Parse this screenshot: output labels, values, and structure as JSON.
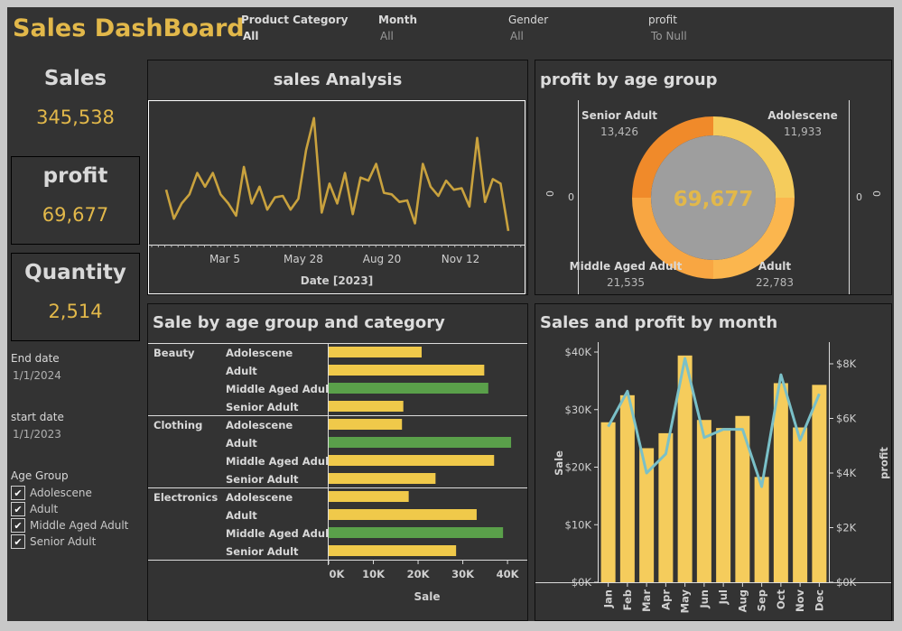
{
  "header": {
    "title": "Sales DashBoard",
    "filters": [
      {
        "label": "Product Category",
        "value": "All"
      },
      {
        "label": "Month",
        "value": "All"
      },
      {
        "label": "Gender",
        "value": "All"
      },
      {
        "label": "profit",
        "value": "To Null"
      }
    ]
  },
  "kpis": {
    "sales_label": "Sales",
    "sales_value": "345,538",
    "profit_label": "profit",
    "profit_value": "69,677",
    "quantity_label": "Quantity",
    "quantity_value": "2,514"
  },
  "sidebar": {
    "end_date_label": "End date",
    "end_date_value": "1/1/2024",
    "start_date_label": "start date",
    "start_date_value": "1/1/2023",
    "age_group_label": "Age Group",
    "age_groups": [
      {
        "label": "Adolescene",
        "checked": true
      },
      {
        "label": "Adult",
        "checked": true
      },
      {
        "label": "Middle Aged Adult",
        "checked": true
      },
      {
        "label": "Senior Adult",
        "checked": true
      }
    ]
  },
  "colors": {
    "accent": "#e2b84a",
    "bar_yellow": "#f0c94a",
    "bar_green": "#5aa04a",
    "line_teal": "#7ac0c8",
    "donut_orange": "#f08a2a"
  },
  "panels": {
    "sales_analysis_title": "sales Analysis",
    "profit_age_title": "profit by age group",
    "age_category_title": "Sale by age group and category",
    "month_title": "Sales and profit by month"
  },
  "chart_data": [
    {
      "type": "line",
      "title": "sales Analysis",
      "xlabel": "Date [2023]",
      "x_ticks": [
        "Mar 5",
        "May 28",
        "Aug 20",
        "Nov 12"
      ],
      "values": [
        5600,
        3700,
        4700,
        5300,
        6700,
        5800,
        6700,
        5300,
        4700,
        3900,
        7100,
        4700,
        5800,
        4300,
        5100,
        5200,
        4300,
        5000,
        8200,
        10300,
        4100,
        6000,
        4700,
        6700,
        4000,
        6400,
        6200,
        7300,
        5400,
        5300,
        4800,
        4900,
        3400,
        7300,
        5800,
        5200,
        6200,
        5600,
        5700,
        4500,
        9000,
        4800,
        6300,
        6000,
        2900
      ],
      "ylim": [
        2000,
        11000
      ]
    },
    {
      "type": "pie",
      "title": "profit by age group",
      "center_value": "69,677",
      "slices": [
        {
          "name": "Adolescene",
          "value": 11933,
          "label": "11,933"
        },
        {
          "name": "Adult",
          "value": 22783,
          "label": "22,783"
        },
        {
          "name": "Middle Aged Adult",
          "value": 21535,
          "label": "21,535"
        },
        {
          "name": "Senior Adult",
          "value": 13426,
          "label": "13,426"
        }
      ],
      "side_axis_labels": [
        "0",
        "0",
        "0",
        "0"
      ]
    },
    {
      "type": "bar",
      "title": "Sale by age group and category",
      "xlabel": "Sale",
      "x_ticks": [
        "0K",
        "10K",
        "20K",
        "30K",
        "40K"
      ],
      "xlim": [
        0,
        42000
      ],
      "groups": [
        {
          "category": "Beauty",
          "rows": [
            {
              "age": "Adolescene",
              "value": 20800,
              "highlight": false
            },
            {
              "age": "Adult",
              "value": 34800,
              "highlight": false
            },
            {
              "age": "Middle Aged Adult",
              "value": 35700,
              "highlight": true
            },
            {
              "age": "Senior Adult",
              "value": 16700,
              "highlight": false
            }
          ]
        },
        {
          "category": "Clothing",
          "rows": [
            {
              "age": "Adolescene",
              "value": 16400,
              "highlight": false
            },
            {
              "age": "Adult",
              "value": 40800,
              "highlight": true
            },
            {
              "age": "Middle Aged Adult",
              "value": 37000,
              "highlight": false
            },
            {
              "age": "Senior Adult",
              "value": 23900,
              "highlight": false
            }
          ]
        },
        {
          "category": "Electronics",
          "rows": [
            {
              "age": "Adolescene",
              "value": 17900,
              "highlight": false
            },
            {
              "age": "Adult",
              "value": 33100,
              "highlight": false
            },
            {
              "age": "Middle Aged Adult",
              "value": 39000,
              "highlight": true
            },
            {
              "age": "Senior Adult",
              "value": 28500,
              "highlight": false
            }
          ]
        }
      ]
    },
    {
      "type": "bar",
      "title": "Sales and profit by month",
      "categories": [
        "Jan",
        "Feb",
        "Mar",
        "Apr",
        "May",
        "Jun",
        "Jul",
        "Aug",
        "Sep",
        "Oct",
        "Nov",
        "Dec"
      ],
      "ylabel": "Sale",
      "y2label": "profit",
      "ylim": [
        0,
        40000
      ],
      "y2lim": [
        0,
        8000
      ],
      "y_ticks": [
        "$0K",
        "$10K",
        "$20K",
        "$30K",
        "$40K"
      ],
      "y2_ticks": [
        "$0K",
        "$2K",
        "$4K",
        "$6K",
        "$8K"
      ],
      "series": [
        {
          "name": "Sale",
          "type": "bar",
          "values": [
            27800,
            32500,
            23300,
            25900,
            39400,
            28200,
            26800,
            28900,
            18300,
            34600,
            26900,
            34300
          ]
        },
        {
          "name": "profit",
          "type": "line",
          "values": [
            5700,
            7000,
            4000,
            4700,
            8200,
            5300,
            5600,
            5600,
            3500,
            7600,
            5200,
            6900
          ]
        }
      ]
    }
  ]
}
